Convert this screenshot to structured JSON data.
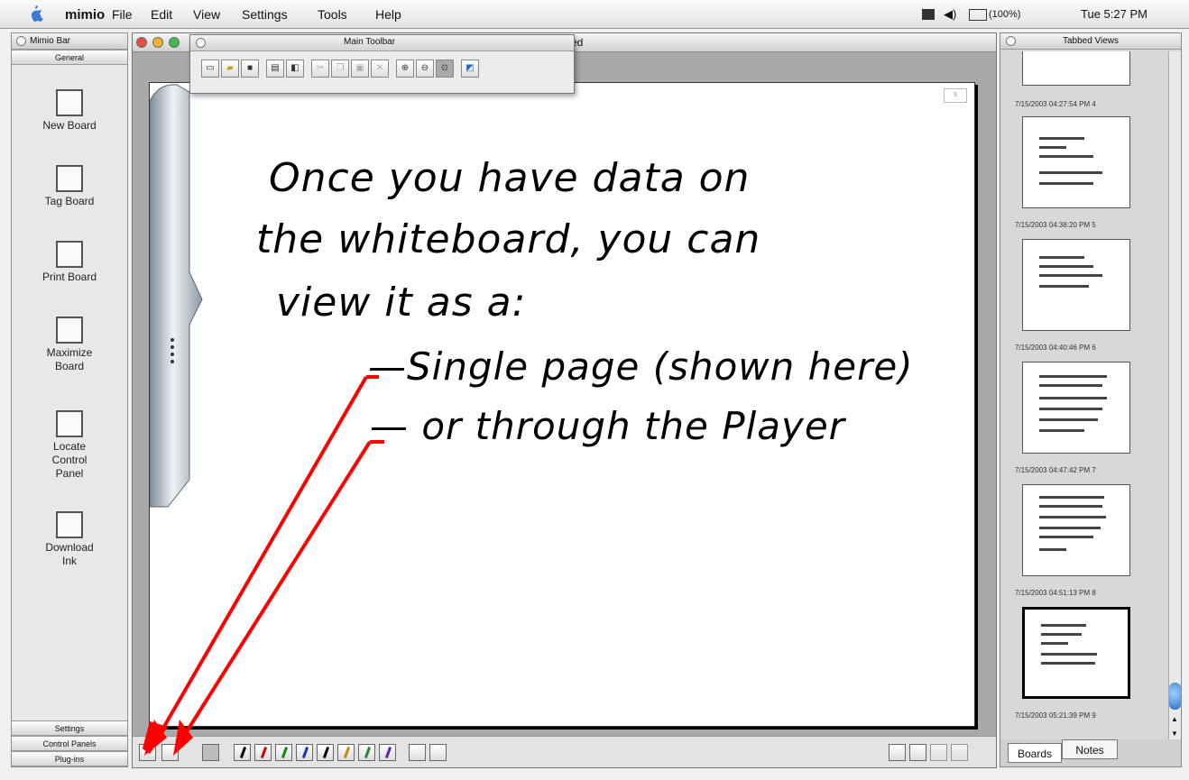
{
  "menubar": {
    "app": "mimio",
    "menus": [
      "File",
      "Edit",
      "View",
      "Settings",
      "Tools",
      "Help"
    ],
    "battery": "(100%)",
    "clock": "Tue 5:27 PM"
  },
  "mimio_bar": {
    "title": "Mimio Bar",
    "section_top": "General",
    "tools": [
      {
        "label": "New Board",
        "icon": "new-board-icon"
      },
      {
        "label": "Tag Board",
        "icon": "tag-board-icon"
      },
      {
        "label": "Print Board",
        "icon": "print-board-icon"
      },
      {
        "label": "Maximize Board",
        "icon": "maximize-board-icon"
      },
      {
        "label": "Locate Control Panel",
        "icon": "locate-control-panel-icon"
      },
      {
        "label": "Download Ink",
        "icon": "download-ink-icon"
      }
    ],
    "sections_bottom": [
      "Settings",
      "Control Panels",
      "Plug-ins"
    ]
  },
  "main_window": {
    "title_fragment": "ed",
    "board_text": [
      "Once you have data on",
      "the whiteboard, you can",
      "view it as a:",
      "—Single page (shown here)",
      "— or through the Player"
    ]
  },
  "main_toolbar": {
    "title": "Main Toolbar"
  },
  "tabbed_views": {
    "title": "Tabbed Views",
    "timestamps": [
      "7/15/2003 04:27:54 PM   4",
      "7/15/2003 04:38:20 PM   5",
      "7/15/2003 04:40:46 PM   6",
      "7/15/2003 04:47:42 PM   7",
      "7/15/2003 04:51:13 PM   8",
      "7/15/2003 05:21:39 PM   9"
    ],
    "tabs": [
      "Boards",
      "Notes"
    ]
  },
  "colors": {
    "arrow": "#ff0000",
    "pens": [
      "#000000",
      "#cc0000",
      "#118811",
      "#1133cc",
      "#000000",
      "#cc8800",
      "#228833",
      "#6622aa"
    ]
  }
}
